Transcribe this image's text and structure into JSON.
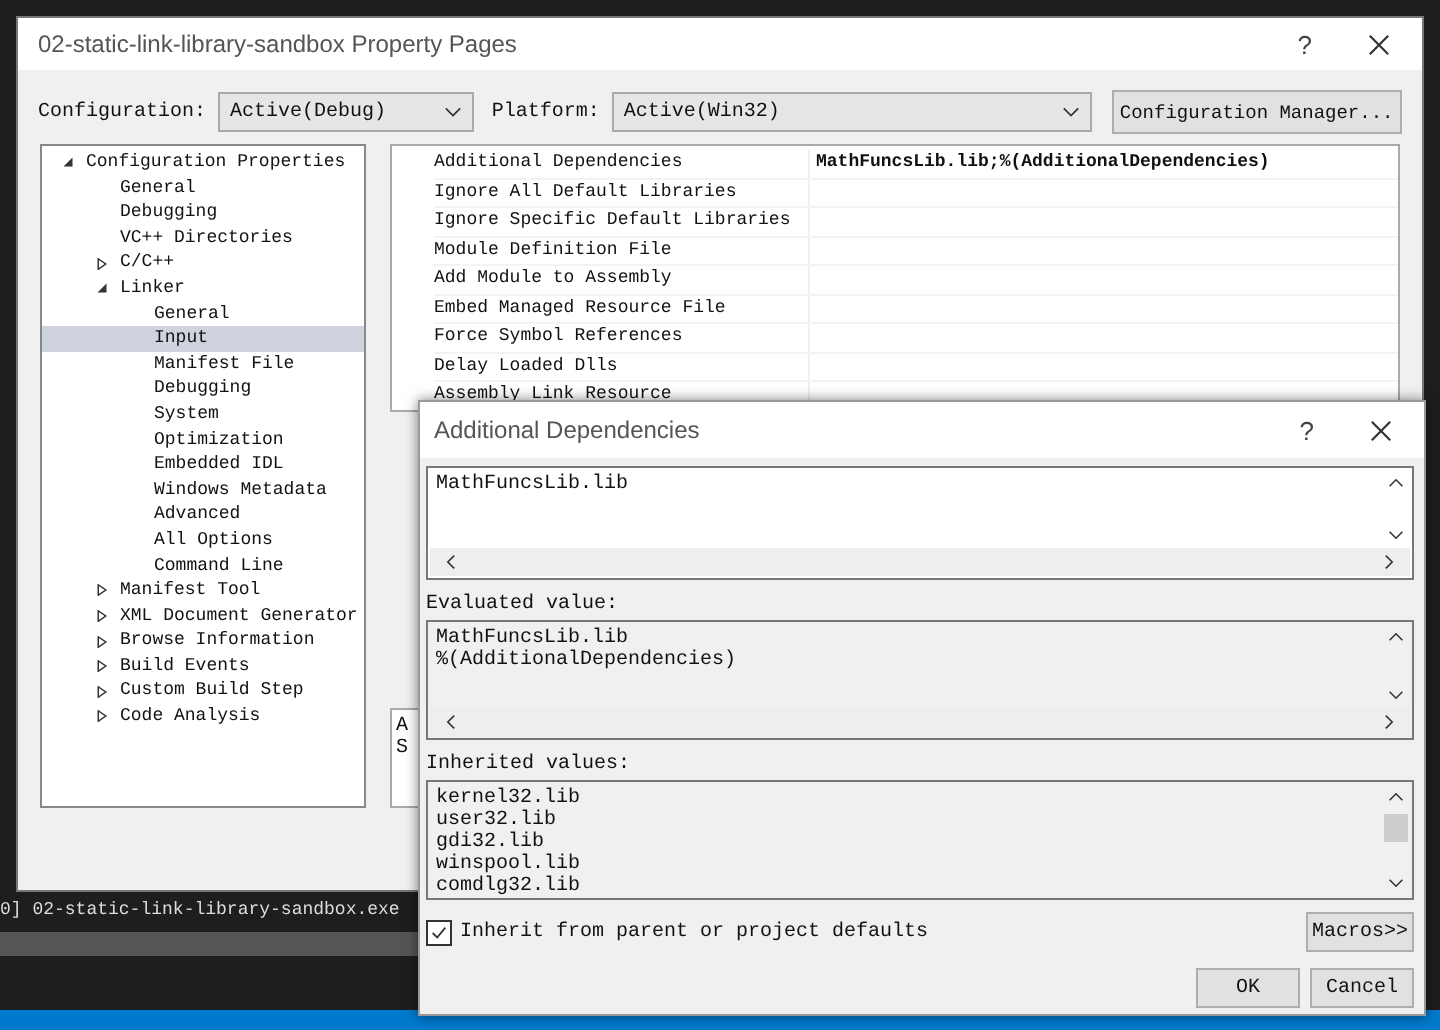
{
  "window": {
    "title": "02-static-link-library-sandbox Property Pages",
    "help": "?"
  },
  "toolbar": {
    "configuration_label": "Configuration:",
    "configuration_value": "Active(Debug)",
    "platform_label": "Platform:",
    "platform_value": "Active(Win32)",
    "manager_button": "Configuration Manager..."
  },
  "tree": [
    {
      "label": "Configuration Properties",
      "expanded": true,
      "selected": false,
      "children": [
        {
          "label": "General",
          "selected": false
        },
        {
          "label": "Debugging",
          "selected": false
        },
        {
          "label": "VC++ Directories",
          "selected": false
        },
        {
          "label": "C/C++",
          "expanded": false,
          "selected": false
        },
        {
          "label": "Linker",
          "expanded": true,
          "selected": false,
          "children": [
            {
              "label": "General",
              "selected": false
            },
            {
              "label": "Input",
              "selected": true
            },
            {
              "label": "Manifest File",
              "selected": false
            },
            {
              "label": "Debugging",
              "selected": false
            },
            {
              "label": "System",
              "selected": false
            },
            {
              "label": "Optimization",
              "selected": false
            },
            {
              "label": "Embedded IDL",
              "selected": false
            },
            {
              "label": "Windows Metadata",
              "selected": false
            },
            {
              "label": "Advanced",
              "selected": false
            },
            {
              "label": "All Options",
              "selected": false
            },
            {
              "label": "Command Line",
              "selected": false
            }
          ]
        },
        {
          "label": "Manifest Tool",
          "expanded": false,
          "selected": false
        },
        {
          "label": "XML Document Generator",
          "expanded": false,
          "selected": false
        },
        {
          "label": "Browse Information",
          "expanded": false,
          "selected": false
        },
        {
          "label": "Build Events",
          "expanded": false,
          "selected": false
        },
        {
          "label": "Custom Build Step",
          "expanded": false,
          "selected": false
        },
        {
          "label": "Code Analysis",
          "expanded": false,
          "selected": false
        }
      ]
    }
  ],
  "properties": [
    {
      "name": "Additional Dependencies",
      "value": "MathFuncsLib.lib;%(AdditionalDependencies)"
    },
    {
      "name": "Ignore All Default Libraries"
    },
    {
      "name": "Ignore Specific Default Libraries"
    },
    {
      "name": "Module Definition File"
    },
    {
      "name": "Add Module to Assembly"
    },
    {
      "name": "Embed Managed Resource File"
    },
    {
      "name": "Force Symbol References"
    },
    {
      "name": "Delay Loaded Dlls"
    },
    {
      "name": "Assembly Link Resource"
    }
  ],
  "description": [
    "A",
    "S"
  ],
  "dialog": {
    "title": "Additional Dependencies",
    "help": "?",
    "value": "MathFuncsLib.lib",
    "evaluated_label": "Evaluated value:",
    "evaluated": [
      "MathFuncsLib.lib",
      "%(AdditionalDependencies)"
    ],
    "inherited_label": "Inherited values:",
    "inherited": [
      "kernel32.lib",
      "user32.lib",
      "gdi32.lib",
      "winspool.lib",
      "comdlg32.lib"
    ],
    "inherit_checkbox": {
      "label": "Inherit from parent or project defaults",
      "checked": true
    },
    "macros_button": "Macros>>",
    "ok_button": "OK",
    "cancel_button": "Cancel"
  },
  "ide_output_line": "0] 02-static-link-library-sandbox.exe"
}
